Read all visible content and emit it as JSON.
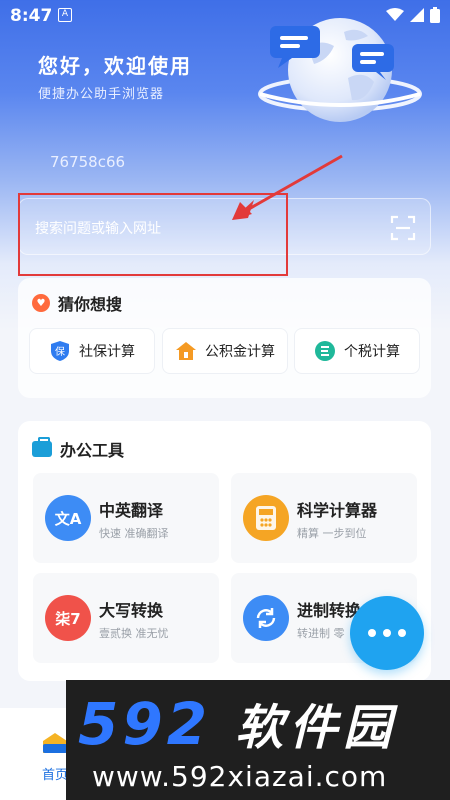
{
  "status_bar": {
    "time": "8:47",
    "sim_label": "A"
  },
  "header": {
    "greeting": "您好，欢迎使用",
    "subtitle": "便捷办公助手浏览器",
    "device_id": "76758c66"
  },
  "search": {
    "placeholder": "搜索问题或输入网址"
  },
  "guess_section": {
    "title": "猜你想搜",
    "chips": [
      {
        "label": "社保计算",
        "icon": "shield-icon",
        "icon_text": "保",
        "color": "#2f7cf0"
      },
      {
        "label": "公积金计算",
        "icon": "house-icon",
        "icon_text": "",
        "color": "#f59a23"
      },
      {
        "label": "个税计算",
        "icon": "tax-icon",
        "icon_text": "",
        "color": "#1fb89a"
      }
    ]
  },
  "tools_section": {
    "title": "办公工具",
    "tools": [
      {
        "title": "中英翻译",
        "subtitle": "快速 准确翻译",
        "icon": "translate-icon",
        "icon_text": "文A",
        "color": "#3d8cf5"
      },
      {
        "title": "科学计算器",
        "subtitle": "精算 一步到位",
        "icon": "calculator-icon",
        "icon_text": "",
        "color": "#f5a524"
      },
      {
        "title": "大写转换",
        "subtitle": "壹贰换 准无忧",
        "icon": "uppercase-icon",
        "icon_text": "柒7",
        "color": "#f0524a"
      },
      {
        "title": "进制转换",
        "subtitle": "转进制 零",
        "icon": "convert-icon",
        "icon_text": "",
        "color": "#3d8cf5"
      }
    ]
  },
  "bottom_nav": {
    "home_label": "首页"
  },
  "watermark": {
    "brand": "592",
    "brand_cn": "软件园",
    "url": "www.592xiazai.com"
  },
  "colors": {
    "accent": "#1fa3f0",
    "highlight": "#e23a3a",
    "nav_active": "#1b6fe0"
  }
}
